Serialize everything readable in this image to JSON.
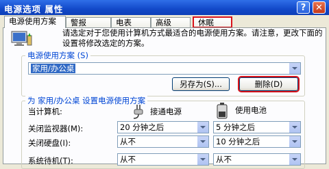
{
  "window": {
    "title": "电源选项 属性",
    "help_glyph": "?",
    "close_glyph": "✕"
  },
  "tabs": [
    {
      "label": "电源使用方案"
    },
    {
      "label": "警报"
    },
    {
      "label": "电表"
    },
    {
      "label": "高级"
    },
    {
      "label": "休眠"
    }
  ],
  "intro_text": "请选定对于您使用计算机方式最适合的电源使用方案。请注意，更改下面的设置将修改选定的方案。",
  "scheme_group": {
    "label": "电源使用方案 (S)",
    "selected": "家用/办公桌",
    "save_as_button": "另存为(S)...",
    "delete_button": "删除(D)"
  },
  "settings_group": {
    "label": "为 家用/办公桌 设置电源使用方案",
    "computer_label": "当计算机:",
    "ac_label": "接通电源",
    "battery_label": "使用电池",
    "rows": [
      {
        "label": "关闭监视器(M):",
        "ac": "20 分钟之后",
        "dc": "5 分钟之后"
      },
      {
        "label": "关闭硬盘(I):",
        "ac": "从不",
        "dc": "10 分钟之后"
      },
      {
        "label": "系统待机(T):",
        "ac": "从不",
        "dc": "从不"
      }
    ]
  },
  "colors": {
    "highlight_outline": "#d8121a",
    "titlebar": "#1249c9",
    "selection": "#316ac5"
  }
}
